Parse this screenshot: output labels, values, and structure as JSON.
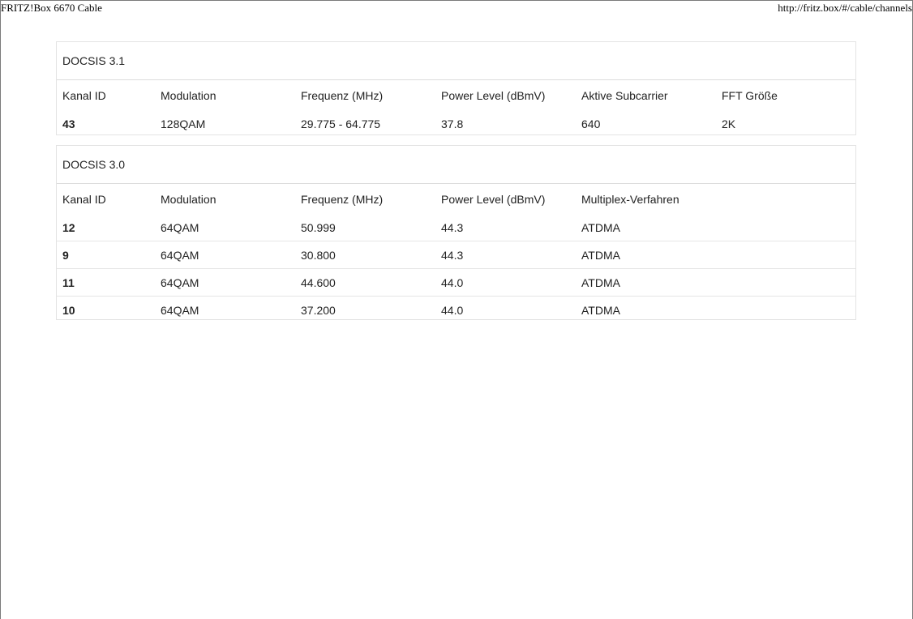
{
  "print_header": {
    "title": "FRITZ!Box 6670 Cable",
    "url": "http://fritz.box/#/cable/channels"
  },
  "docsis31": {
    "heading": "DOCSIS 3.1",
    "columns": [
      "Kanal ID",
      "Modulation",
      "Frequenz (MHz)",
      "Power Level (dBmV)",
      "Aktive Subcarrier",
      "FFT Größe"
    ],
    "rows": [
      [
        "43",
        "128QAM",
        "29.775 - 64.775",
        "37.8",
        "640",
        "2K"
      ]
    ]
  },
  "docsis30": {
    "heading": "DOCSIS 3.0",
    "columns": [
      "Kanal ID",
      "Modulation",
      "Frequenz (MHz)",
      "Power Level (dBmV)",
      "Multiplex-Verfahren",
      ""
    ],
    "rows": [
      [
        "12",
        "64QAM",
        "50.999",
        "44.3",
        "ATDMA",
        ""
      ],
      [
        "9",
        "64QAM",
        "30.800",
        "44.3",
        "ATDMA",
        ""
      ],
      [
        "11",
        "64QAM",
        "44.600",
        "44.0",
        "ATDMA",
        ""
      ],
      [
        "10",
        "64QAM",
        "37.200",
        "44.0",
        "ATDMA",
        ""
      ]
    ]
  }
}
